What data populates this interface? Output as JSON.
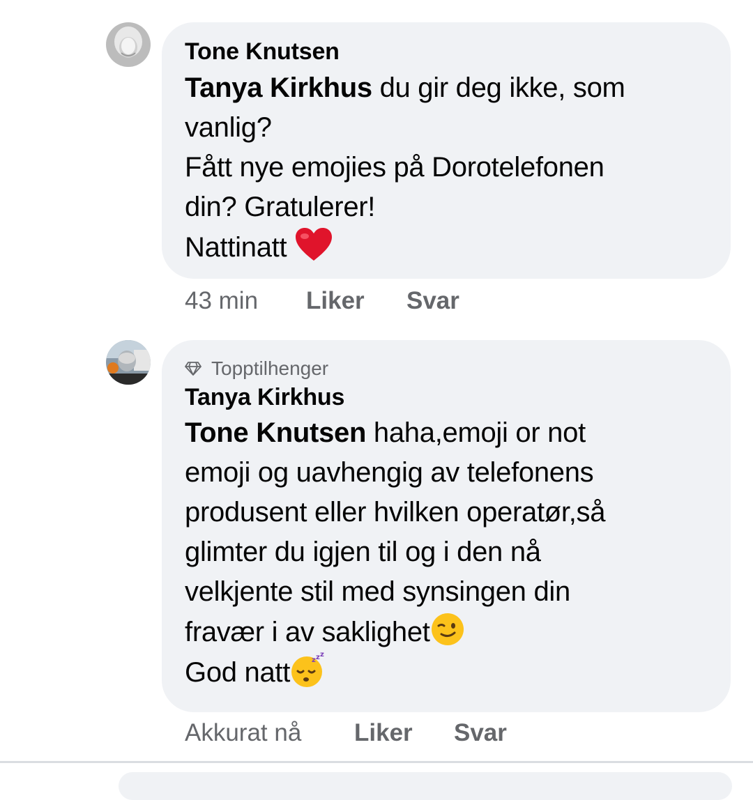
{
  "comments": [
    {
      "author": "Tone Knutsen",
      "mention": "Tanya Kirkhus",
      "lines": {
        "l1_rest": " du gir deg ikke, som",
        "l2": "vanlig?",
        "l3": "Fått nye emojies på Dorotelefonen",
        "l4": "din? Gratulerer!",
        "l5": "Nattinatt"
      },
      "emoji": "red-heart",
      "time": "43 min",
      "like_label": "Liker",
      "reply_label": "Svar"
    },
    {
      "badge": "Topptilhenger",
      "author": "Tanya Kirkhus",
      "mention": "Tone Knutsen",
      "lines": {
        "l1_rest": " haha,emoji or not",
        "l2": "emoji og uavhengig av telefonens",
        "l3": "produsent eller hvilken operatør,så",
        "l4": "glimter du igjen til og i den nå",
        "l5": "velkjente stil med synsingen din",
        "l6": "fravær i av saklighet",
        "l7": "God natt"
      },
      "emojis": [
        "winking-face",
        "sleeping-face"
      ],
      "time": "Akkurat nå",
      "like_label": "Liker",
      "reply_label": "Svar"
    }
  ],
  "colors": {
    "bubble": "#f0f2f5",
    "meta_text": "#65676b",
    "text": "#050505"
  }
}
